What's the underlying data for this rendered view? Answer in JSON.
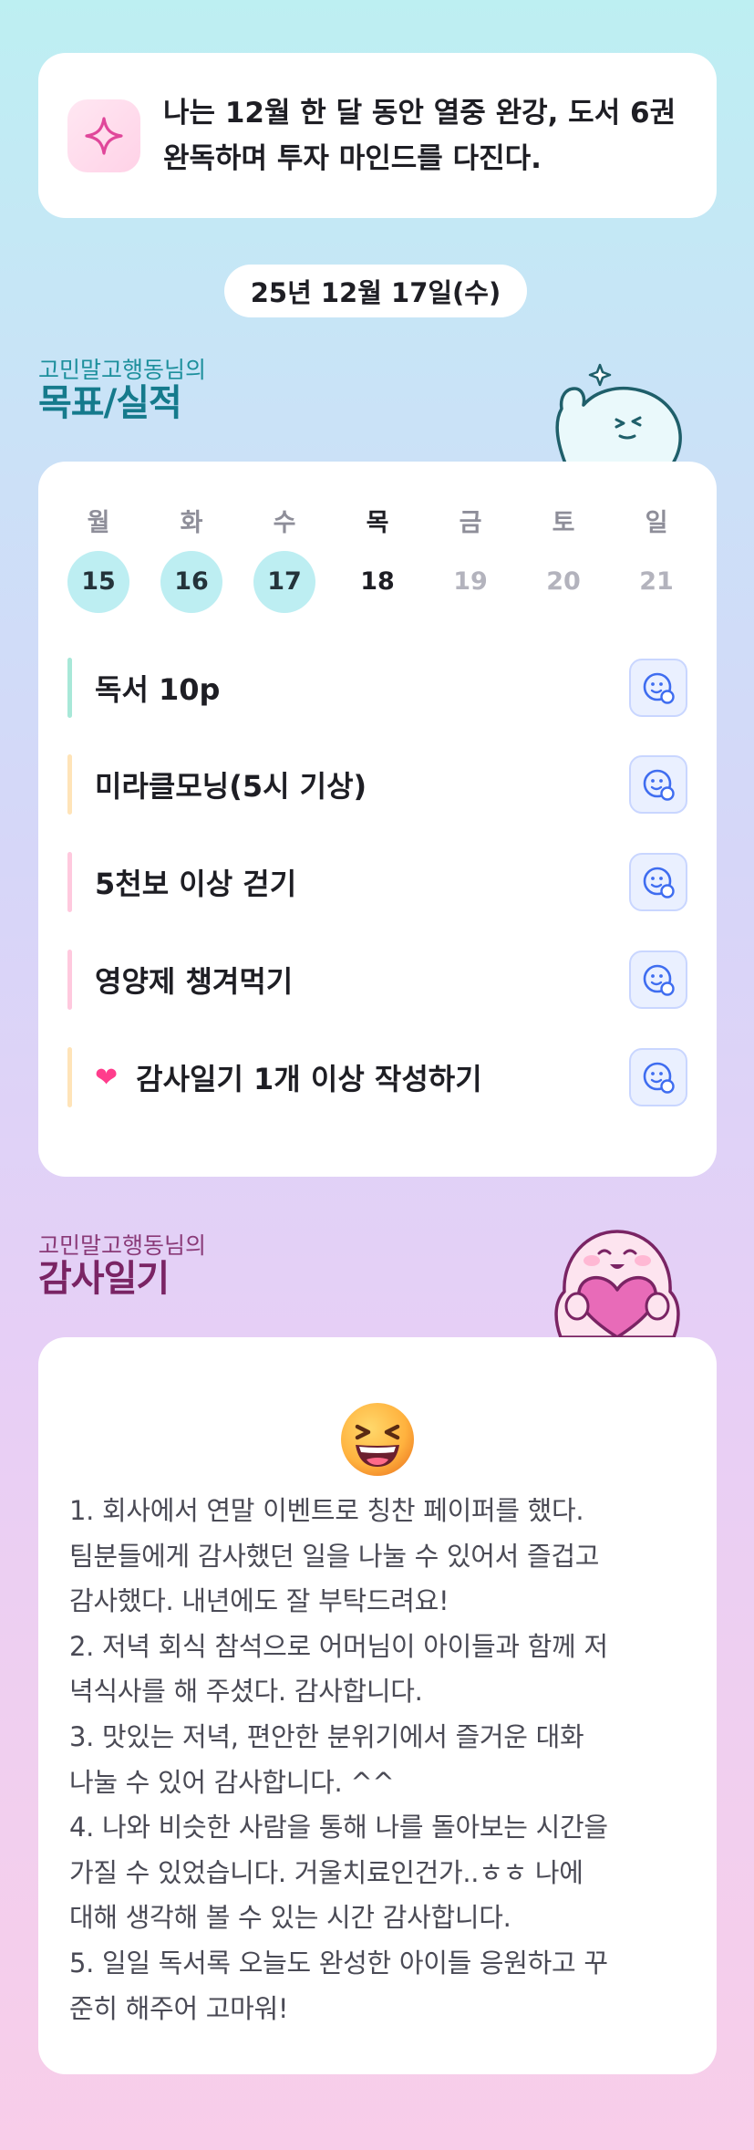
{
  "goal": {
    "text": "나는 12월 한 달 동안 열중 완강, 도서 6권 완독하며 투자 마인드를 다진다.",
    "icon": "sparkle-icon"
  },
  "date": "25년 12월 17일(수)",
  "goals_section": {
    "subtitle": "고민말고행동님의",
    "title": "목표/실적"
  },
  "week": [
    {
      "name": "월",
      "num": "15",
      "state": "done"
    },
    {
      "name": "화",
      "num": "16",
      "state": "done"
    },
    {
      "name": "수",
      "num": "17",
      "state": "done"
    },
    {
      "name": "목",
      "num": "18",
      "state": "today"
    },
    {
      "name": "금",
      "num": "19",
      "state": "future"
    },
    {
      "name": "토",
      "num": "20",
      "state": "future"
    },
    {
      "name": "일",
      "num": "21",
      "state": "future"
    }
  ],
  "tasks": [
    {
      "label": "독서 10p",
      "bar_color": "#a8e8d8",
      "icon": "smile-check-icon"
    },
    {
      "label": "미라클모닝(5시 기상)",
      "bar_color": "#ffe4b8",
      "icon": "smile-check-icon"
    },
    {
      "label": "5천보 이상 걷기",
      "bar_color": "#ffc9de",
      "icon": "smile-check-icon"
    },
    {
      "label": "영양제 챙겨먹기",
      "bar_color": "#ffc9de",
      "icon": "smile-check-icon"
    },
    {
      "label": "감사일기 1개 이상 작성하기",
      "bar_color": "#ffe4b8",
      "icon": "smile-check-icon",
      "prefix_icon": "heart-icon"
    }
  ],
  "diary_section": {
    "subtitle": "고민말고행동님의",
    "title": "감사일기"
  },
  "diary": {
    "emoji": "laughing-face-icon",
    "text": "1. 회사에서 연말 이벤트로 칭찬 페이퍼를 했다.\n팀분들에게 감사했던 일을 나눌 수 있어서 즐겁고\n감사했다. 내년에도 잘 부탁드려요!\n2. 저녁 회식 참석으로 어머님이 아이들과 함께 저\n녁식사를 해 주셨다. 감사합니다.\n3. 맛있는 저녁, 편안한 분위기에서 즐거운 대화\n나눌 수 있어 감사합니다. ^^\n4. 나와 비슷한 사람을 통해 나를 돌아보는 시간을\n가질 수 있었습니다. 거울치료인건가..ㅎㅎ 나에\n대해 생각해 볼 수 있는 시간 감사합니다.\n5. 일일 독서록 오늘도 완성한 아이들 응원하고 꾸\n준히 해주어 고마워!"
  },
  "colors": {
    "goals_title": "#157a8c",
    "diary_title": "#7a2464",
    "done_circle": "#bdeef2",
    "check_button": "#eaf0ff",
    "check_icon": "#3f6df0"
  }
}
